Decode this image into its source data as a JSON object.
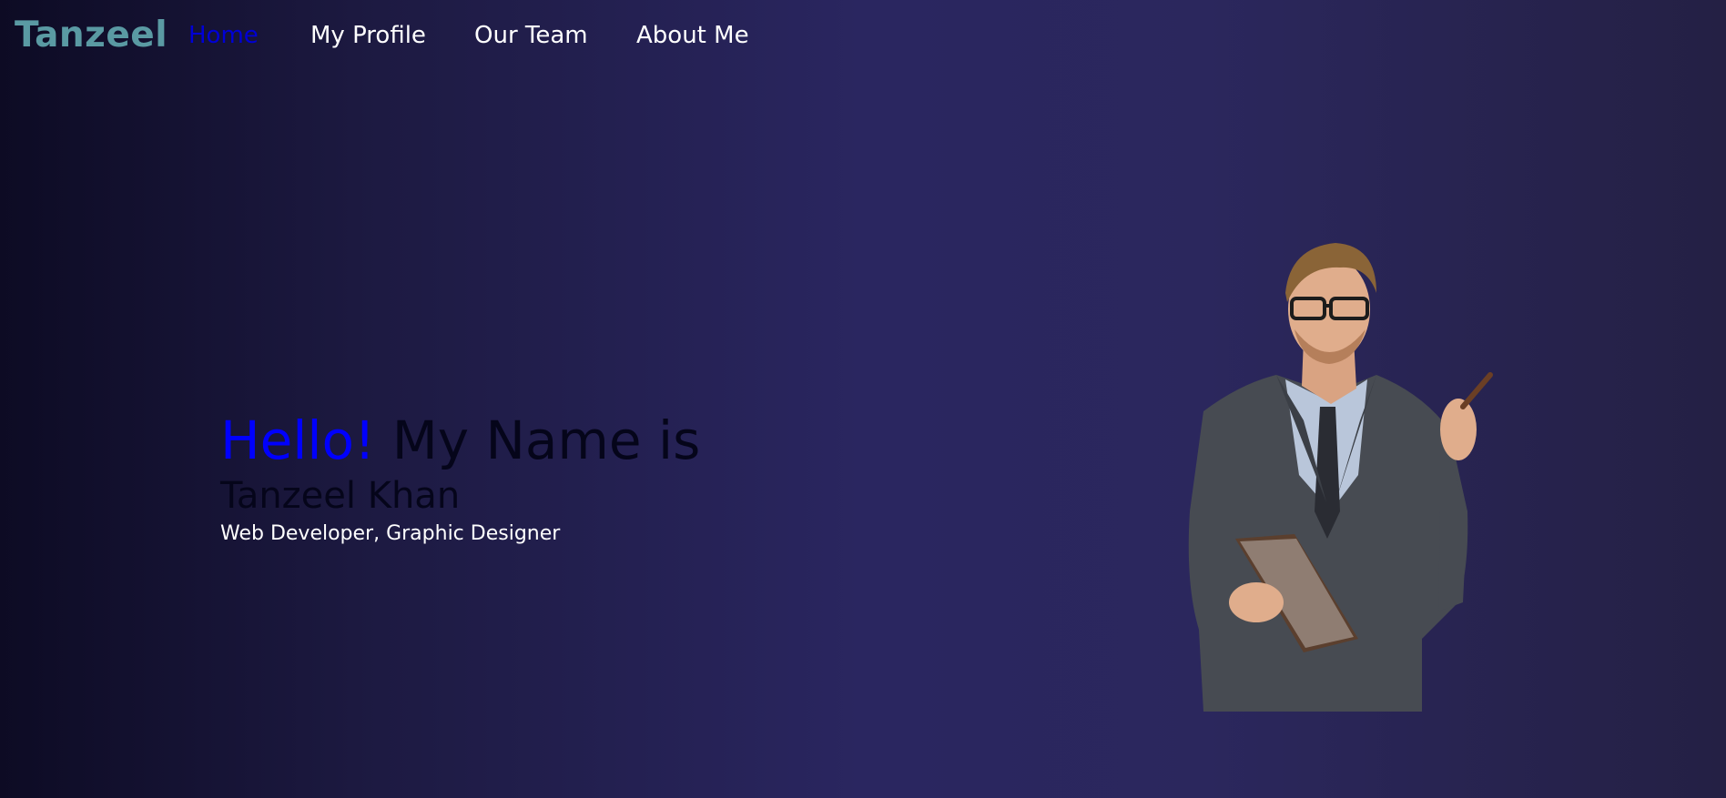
{
  "navbar": {
    "brand": "Tanzeel",
    "links": [
      {
        "label": "Home",
        "active": true
      },
      {
        "label": "My Profile",
        "active": false
      },
      {
        "label": "Our Team",
        "active": false
      },
      {
        "label": "About Me",
        "active": false
      }
    ]
  },
  "hero": {
    "hello": "Hello!",
    "intro": "My Name is",
    "name": "Tanzeel Khan",
    "role": "Web Developer, Graphic Designer",
    "image": "businessman-with-notebook-and-pen"
  },
  "colors": {
    "brand": "#5a9aa3",
    "active_link": "#0000d6",
    "hello": "#0000ff",
    "background_mid": "#2a2660"
  }
}
